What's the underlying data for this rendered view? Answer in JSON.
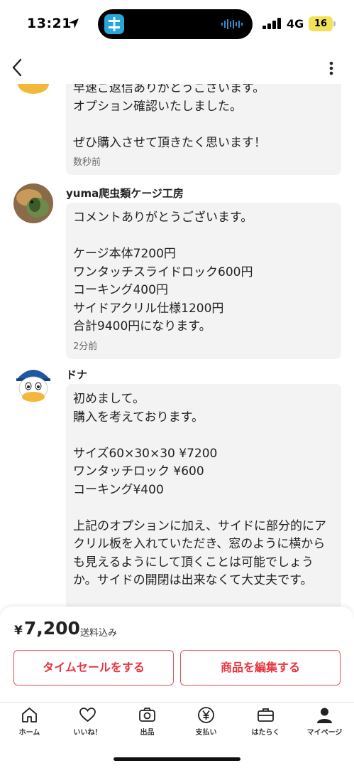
{
  "status_bar": {
    "time": "13:21",
    "network": "4G",
    "battery": "16"
  },
  "messages": [
    {
      "sender": "",
      "text": "早速ご返信ありがとうございます。\nオプション確認いたしました。\n\nぜひ購入させて頂きたく思います！",
      "time": "数秒前"
    },
    {
      "sender": "yuma爬虫類ケージ工房",
      "text": "コメントありがとうございます。\n\nケージ本体7200円\nワンタッチスライドロック600円\nコーキング400円\nサイドアクリル仕様1200円\n合計9400円になります。",
      "time": "2分前"
    },
    {
      "sender": "ドナ",
      "text": "初めまして。\n購入を考えております。\n\nサイズ60×30×30 ¥7200\nワンタッチロック ¥600\nコーキング¥400\n\n上記のオプションに加え、サイドに部分的にア\nクリル板を入れていただき、窓のように横から\nも見えるようにして頂くことは可能でしょう\nか。サイドの開閉は出来なくて大丈夫です。\n\n可能でしたら、お見積もりをいただきたく思い",
      "time": ""
    }
  ],
  "bottom": {
    "price_symbol": "¥",
    "price_value": "7,200",
    "shipping": "送料込み",
    "timesale_label": "タイムセールをする",
    "edit_label": "商品を編集する"
  },
  "tabs": [
    {
      "label": "ホーム",
      "icon": "home-icon"
    },
    {
      "label": "いいね！",
      "icon": "heart-icon"
    },
    {
      "label": "出品",
      "icon": "camera-icon"
    },
    {
      "label": "支払い",
      "icon": "yen-icon"
    },
    {
      "label": "はたらく",
      "icon": "briefcase-icon"
    },
    {
      "label": "マイページ",
      "icon": "person-icon"
    }
  ],
  "colors": {
    "accent": "#e8353f",
    "bubble": "#f3f3f3",
    "battery": "#f3e257"
  }
}
